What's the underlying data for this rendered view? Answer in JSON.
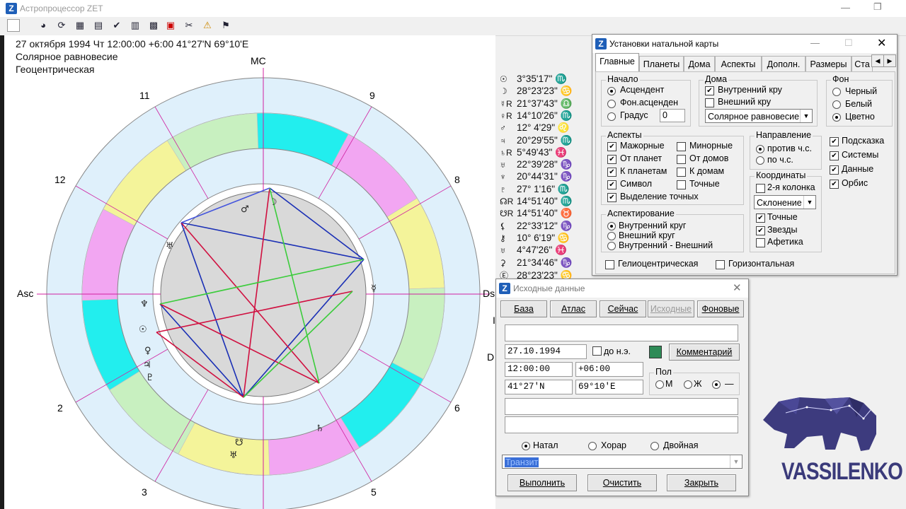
{
  "app": {
    "title": "Астропроцессор ZET",
    "logo_letter": "Z"
  },
  "chart_header": {
    "line1": "27 октября 1994  Чт  12:00:00 +6:00 41°27'N  69°10'E",
    "line2": "Солярное равновесие",
    "line3": "Геоцентрическая"
  },
  "wheel": {
    "mc": "MC",
    "asc": "Asc",
    "dsc": "Ds",
    "houses": [
      "11",
      "9",
      "12",
      "8",
      "2",
      "6",
      "3",
      "5"
    ],
    "partial_labels": [
      "I",
      "D"
    ],
    "colors": {
      "fire": "#f2a6f2",
      "earth": "#f4f49a",
      "air": "#c8f0c0",
      "water": "#22eeee",
      "ring": "#dff0fb",
      "inner": "#d9d9d9"
    }
  },
  "planets": [
    {
      "sym": "☉",
      "text": "3°35'17\" ♏"
    },
    {
      "sym": "☽",
      "text": "28°23'23\" ♋"
    },
    {
      "sym": "☿R",
      "text": "21°37'43\" ♎"
    },
    {
      "sym": "♀R",
      "text": "14°10'26\" ♏"
    },
    {
      "sym": "♂",
      "text": "12° 4'29\" ♌"
    },
    {
      "sym": "♃",
      "text": "20°29'55\" ♏"
    },
    {
      "sym": "♄R",
      "text": "5°49'43\" ♓"
    },
    {
      "sym": "♅",
      "text": "22°39'28\" ♑"
    },
    {
      "sym": "♆",
      "text": "20°44'31\" ♑"
    },
    {
      "sym": "♇",
      "text": "27° 1'16\" ♏"
    },
    {
      "sym": "☊R",
      "text": "14°51'40\" ♏"
    },
    {
      "sym": "☋R",
      "text": "14°51'40\" ♉"
    },
    {
      "sym": "⚸",
      "text": "22°33'12\" ♑"
    },
    {
      "sym": "⚷",
      "text": "10° 6'19\" ♋"
    },
    {
      "sym": "♅",
      "text": "4°47'26\" ♓"
    },
    {
      "sym": "⚳",
      "text": "21°34'46\" ♑"
    },
    {
      "sym": "Ⓔ",
      "text": "28°23'23\" ♋"
    }
  ],
  "settings": {
    "title": "Установки натальной карты",
    "tabs": [
      "Главные",
      "Планеты",
      "Дома",
      "Аспекты",
      "Дополн.",
      "Размеры",
      "Ста"
    ],
    "nachalo": {
      "legend": "Начало",
      "options": [
        "Асцендент",
        "Фон.асценден",
        "Градус"
      ],
      "degree_value": "0"
    },
    "doma": {
      "legend": "Дома",
      "inner": "Внутренний кру",
      "outer": "Внешний кру",
      "system": "Солярное равновесие"
    },
    "fon": {
      "legend": "Фон",
      "options": [
        "Черный",
        "Белый",
        "Цветно"
      ]
    },
    "aspects": {
      "legend": "Аспекты",
      "left": [
        "Мажорные",
        "От планет",
        "К планетам",
        "Символ",
        "Выделение точных"
      ],
      "right": [
        "Минорные",
        "От домов",
        "К домам",
        "Точные"
      ]
    },
    "direction": {
      "legend": "Направление",
      "options": [
        "против ч.с.",
        "по ч.с."
      ]
    },
    "coords": {
      "legend": "Координаты",
      "second_col": "2-я колонка",
      "value": "Склонение",
      "checks": [
        "Точные",
        "Звезды",
        "Афетика"
      ]
    },
    "right_checks": [
      "Подсказка",
      "Системы",
      "Данные",
      "Орбис"
    ],
    "aspecting": {
      "legend": "Аспектирование",
      "options": [
        "Внутренний круг",
        "Внешний круг",
        "Внутренний - Внешний"
      ]
    },
    "helio": "Гелиоцентрическая",
    "horizontal": "Горизонтальная"
  },
  "source": {
    "title": "Исходные данные",
    "buttons": [
      "База",
      "Атлас",
      "Сейчас",
      "Исходные",
      "Фоновые"
    ],
    "name_value": "",
    "date": "27.10.1994",
    "bc_label": "до н.э.",
    "comment_button": "Комментарий",
    "time": "12:00:00",
    "tz": "+06:00",
    "lat": "41°27'N",
    "lon": "69°10'E",
    "gender": {
      "legend": "Пол",
      "options": [
        "М",
        "Ж",
        "—"
      ]
    },
    "extra1": "",
    "extra2": "",
    "modes": [
      "Натал",
      "Хорар",
      "Двойная"
    ],
    "transit": "Транзит",
    "actions": [
      "Выполнить",
      "Очистить",
      "Закрыть"
    ]
  },
  "watermark": {
    "text": "VASSILENKO",
    "color": "#3a3a7a"
  }
}
